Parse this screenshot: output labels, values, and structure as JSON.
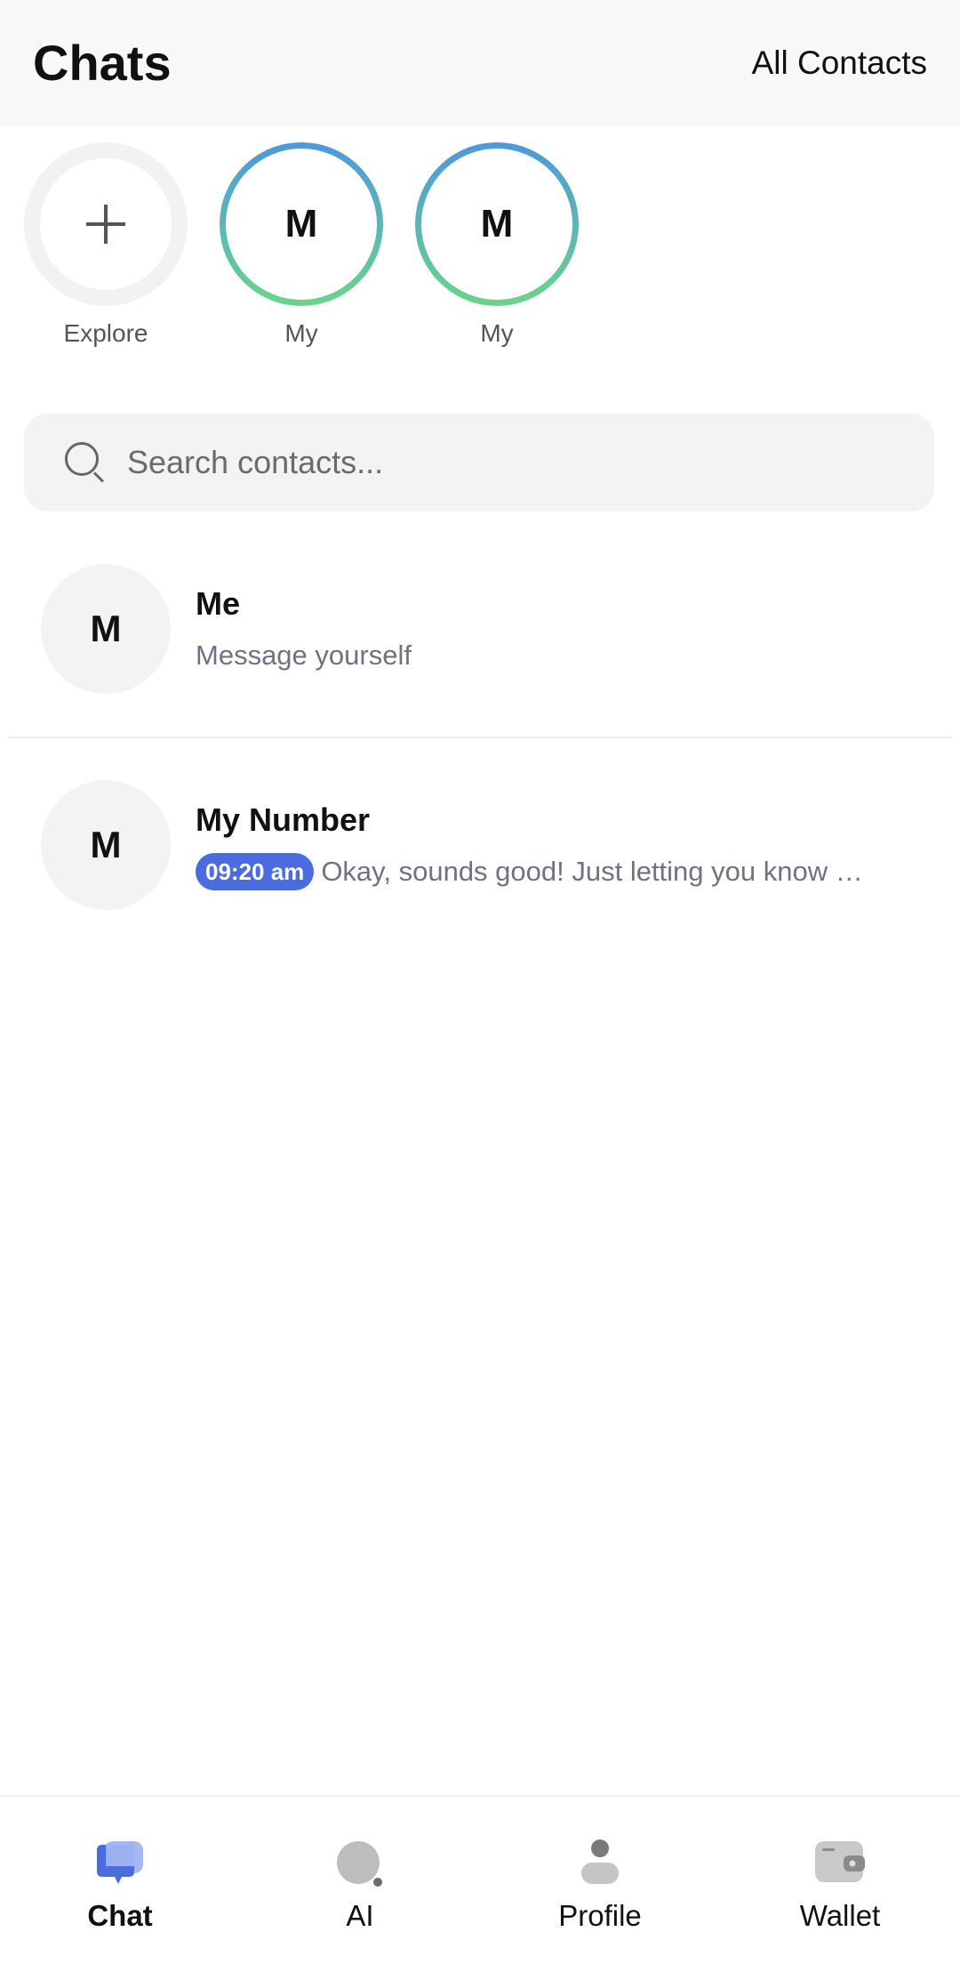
{
  "header": {
    "title": "Chats",
    "action": "All Contacts"
  },
  "stories": [
    {
      "label": "Explore",
      "initial": "",
      "icon": "plus-icon"
    },
    {
      "label": "My",
      "initial": "M"
    },
    {
      "label": "My",
      "initial": "M"
    }
  ],
  "search": {
    "placeholder": "Search contacts...",
    "value": ""
  },
  "chats": [
    {
      "initial": "M",
      "name": "Me",
      "preview": "Message yourself",
      "time": ""
    },
    {
      "initial": "M",
      "name": "My Number",
      "preview": "Okay, sounds good! Just letting you know …",
      "time": "09:20 am"
    }
  ],
  "nav": [
    {
      "label": "Chat",
      "icon": "chat-icon",
      "active": true
    },
    {
      "label": "AI",
      "icon": "ai-icon",
      "active": false
    },
    {
      "label": "Profile",
      "icon": "profile-icon",
      "active": false
    },
    {
      "label": "Wallet",
      "icon": "wallet-icon",
      "active": false
    }
  ],
  "colors": {
    "accent": "#4a6cde",
    "story_ring_top": "#4e98dd",
    "story_ring_bottom": "#6bd48a",
    "inactive_icon": "#bdbdbd"
  }
}
